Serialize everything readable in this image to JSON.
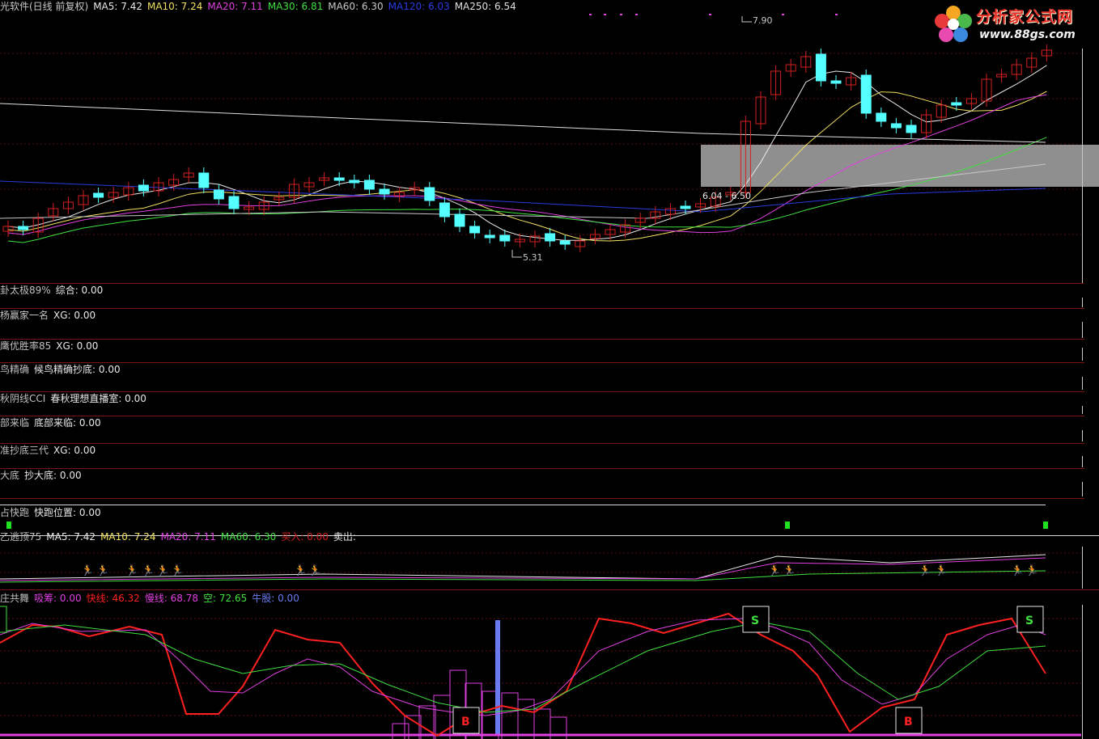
{
  "colors": {
    "up": "#d42020",
    "down": "#54ffff",
    "ma5": "#e8e8e8",
    "ma10": "#f0e060",
    "ma20": "#e040e0",
    "ma30": "#40e040",
    "ma60": "#c8c8c8",
    "ma120": "#2a3ae0",
    "ma250": "#e0e0e0",
    "separator": "#7a1414",
    "fast": "#ff2020",
    "slow": "#e040e0",
    "kong": "#40e040"
  },
  "main": {
    "title": "光软件(日线 前复权)",
    "ma": [
      {
        "label": "MA5: 7.42",
        "color": "#e8e8e8"
      },
      {
        "label": "MA10: 7.24",
        "color": "#f0e060"
      },
      {
        "label": "MA20: 7.11",
        "color": "#e040e0"
      },
      {
        "label": "MA30: 6.81",
        "color": "#40e040"
      },
      {
        "label": "MA60: 6.30",
        "color": "#c8c8c8"
      },
      {
        "label": "MA120: 6.03",
        "color": "#2a3ae0"
      },
      {
        "label": "MA250: 6.54",
        "color": "#e0e0e0"
      }
    ],
    "high_label": "7.90",
    "low_label": "5.31",
    "zone_label": "6.04 - 6.50"
  },
  "logo": {
    "cn": "分析家公式网",
    "url": "www.88gs.com"
  },
  "panels": [
    {
      "name": "卦太极89%",
      "value_label": "综合: 0.00"
    },
    {
      "name": "杨赢家一名",
      "value_label": "XG: 0.00"
    },
    {
      "name": "鹰优胜率85",
      "value_label": "XG: 0.00"
    },
    {
      "name": "鸟精确",
      "value_label": "候鸟精确抄底: 0.00"
    },
    {
      "name": "秋阴线CCI",
      "value_label": "春秋理想直播室: 0.00"
    },
    {
      "name": "部来临",
      "value_label": "底部来临: 0.00"
    },
    {
      "name": "准抄底三代",
      "value_label": "XG: 0.00"
    },
    {
      "name": "大底",
      "value_label": "抄大底: 0.00"
    },
    {
      "name": "占快跑",
      "value_label": "快跑位置: 0.00"
    }
  ],
  "escape_panel": {
    "name": "乙逃顶75",
    "items": [
      {
        "label": "MA5: 7.42",
        "color": "#e8e8e8"
      },
      {
        "label": "MA10: 7.24",
        "color": "#f0e060"
      },
      {
        "label": "MA20: 7.11",
        "color": "#e040e0"
      },
      {
        "label": "MA60: 6.30",
        "color": "#40e040"
      },
      {
        "label": "买入: 0.00",
        "color": "#d42020"
      },
      {
        "label": "卖出:",
        "color": "#e8e8e8"
      }
    ]
  },
  "dance_panel": {
    "name": "庄共舞",
    "items": [
      {
        "label": "吸筹: 0.00",
        "color": "#e040e0"
      },
      {
        "label": "快线: 46.32",
        "color": "#ff2020"
      },
      {
        "label": "慢线: 68.78",
        "color": "#e040e0"
      },
      {
        "label": "空: 72.65",
        "color": "#40e040"
      },
      {
        "label": "牛股: 0.00",
        "color": "#6a7af0"
      }
    ],
    "signals": {
      "buy": "B",
      "sell": "S"
    }
  }
}
